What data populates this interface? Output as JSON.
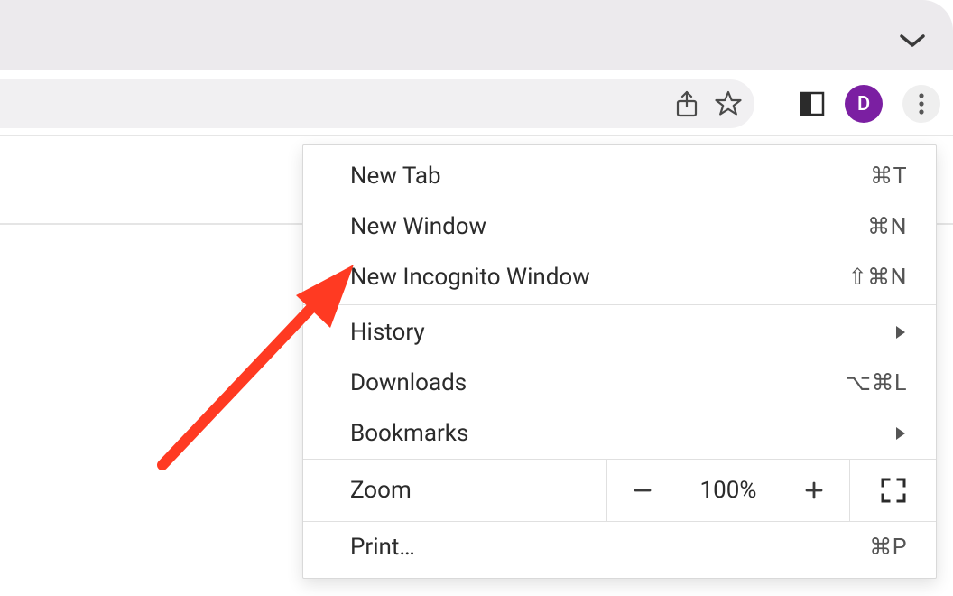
{
  "tabstrip": {},
  "toolbar": {
    "avatar_letter": "D"
  },
  "menu": {
    "new_tab": {
      "label": "New Tab",
      "shortcut": "⌘T"
    },
    "new_window": {
      "label": "New Window",
      "shortcut": "⌘N"
    },
    "new_incognito": {
      "label": "New Incognito Window",
      "shortcut": "⇧⌘N"
    },
    "history": {
      "label": "History"
    },
    "downloads": {
      "label": "Downloads",
      "shortcut": "⌥⌘L"
    },
    "bookmarks": {
      "label": "Bookmarks"
    },
    "zoom": {
      "label": "Zoom",
      "value": "100%"
    },
    "print": {
      "label": "Print…",
      "shortcut": "⌘P"
    }
  },
  "annotation": {
    "target": "new_incognito",
    "color": "#ff3a22"
  }
}
